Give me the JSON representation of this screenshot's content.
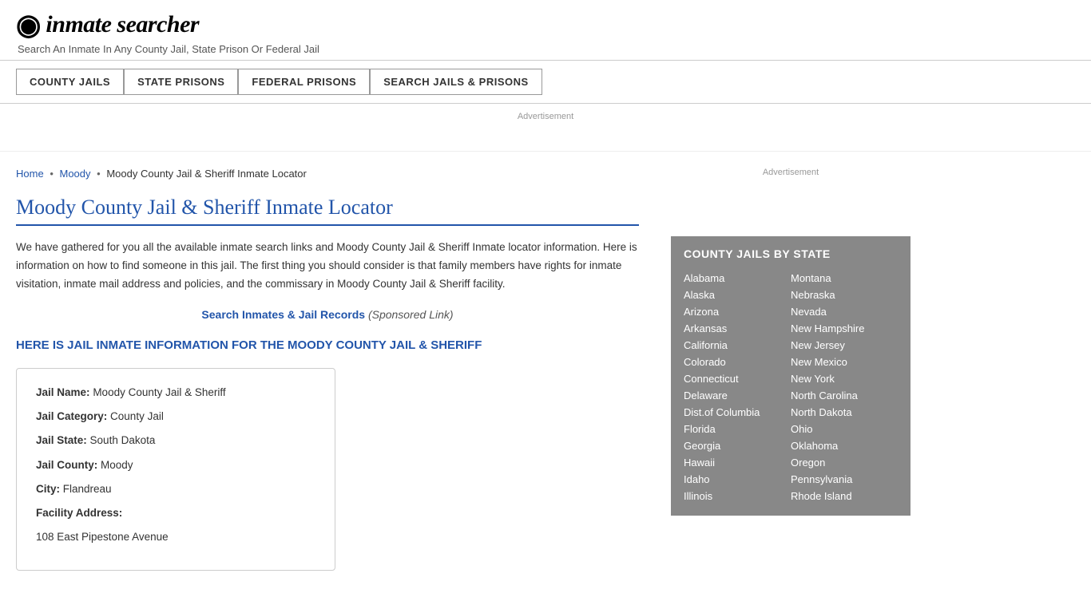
{
  "header": {
    "logo_icon": "🔍",
    "logo_text": "inmate searcher",
    "tagline": "Search An Inmate In Any County Jail, State Prison Or Federal Jail"
  },
  "nav": {
    "buttons": [
      {
        "label": "COUNTY JAILS"
      },
      {
        "label": "STATE PRISONS"
      },
      {
        "label": "FEDERAL PRISONS"
      },
      {
        "label": "SEARCH JAILS & PRISONS"
      }
    ]
  },
  "ad_top_label": "Advertisement",
  "breadcrumb": {
    "home": "Home",
    "parent": "Moody",
    "current": "Moody County Jail & Sheriff Inmate Locator"
  },
  "page_title": "Moody County Jail & Sheriff Inmate Locator",
  "description": "We have gathered for you all the available inmate search links and Moody County Jail & Sheriff Inmate locator information. Here is information on how to find someone in this jail. The first thing you should consider is that family members have rights for inmate visitation, inmate mail address and policies, and the commissary in Moody County Jail & Sheriff facility.",
  "sponsored": {
    "link_text": "Search Inmates & Jail Records",
    "label": "(Sponsored Link)"
  },
  "inmate_heading": "HERE IS JAIL INMATE INFORMATION FOR THE MOODY COUNTY JAIL & SHERIFF",
  "info_box": {
    "fields": [
      {
        "label": "Jail Name:",
        "value": "Moody County Jail & Sheriff"
      },
      {
        "label": "Jail Category:",
        "value": "County Jail"
      },
      {
        "label": "Jail State:",
        "value": "South Dakota"
      },
      {
        "label": "Jail County:",
        "value": "Moody"
      },
      {
        "label": "City:",
        "value": "Flandreau"
      },
      {
        "label": "Facility Address:",
        "value": ""
      },
      {
        "label": "",
        "value": "108 East Pipestone Avenue"
      }
    ]
  },
  "sidebar": {
    "ad_label": "Advertisement",
    "jails_by_state_title": "COUNTY JAILS BY STATE",
    "states_left": [
      "Alabama",
      "Alaska",
      "Arizona",
      "Arkansas",
      "California",
      "Colorado",
      "Connecticut",
      "Delaware",
      "Dist.of Columbia",
      "Florida",
      "Georgia",
      "Hawaii",
      "Idaho",
      "Illinois"
    ],
    "states_right": [
      "Montana",
      "Nebraska",
      "Nevada",
      "New Hampshire",
      "New Jersey",
      "New Mexico",
      "New York",
      "North Carolina",
      "North Dakota",
      "Ohio",
      "Oklahoma",
      "Oregon",
      "Pennsylvania",
      "Rhode Island"
    ]
  }
}
